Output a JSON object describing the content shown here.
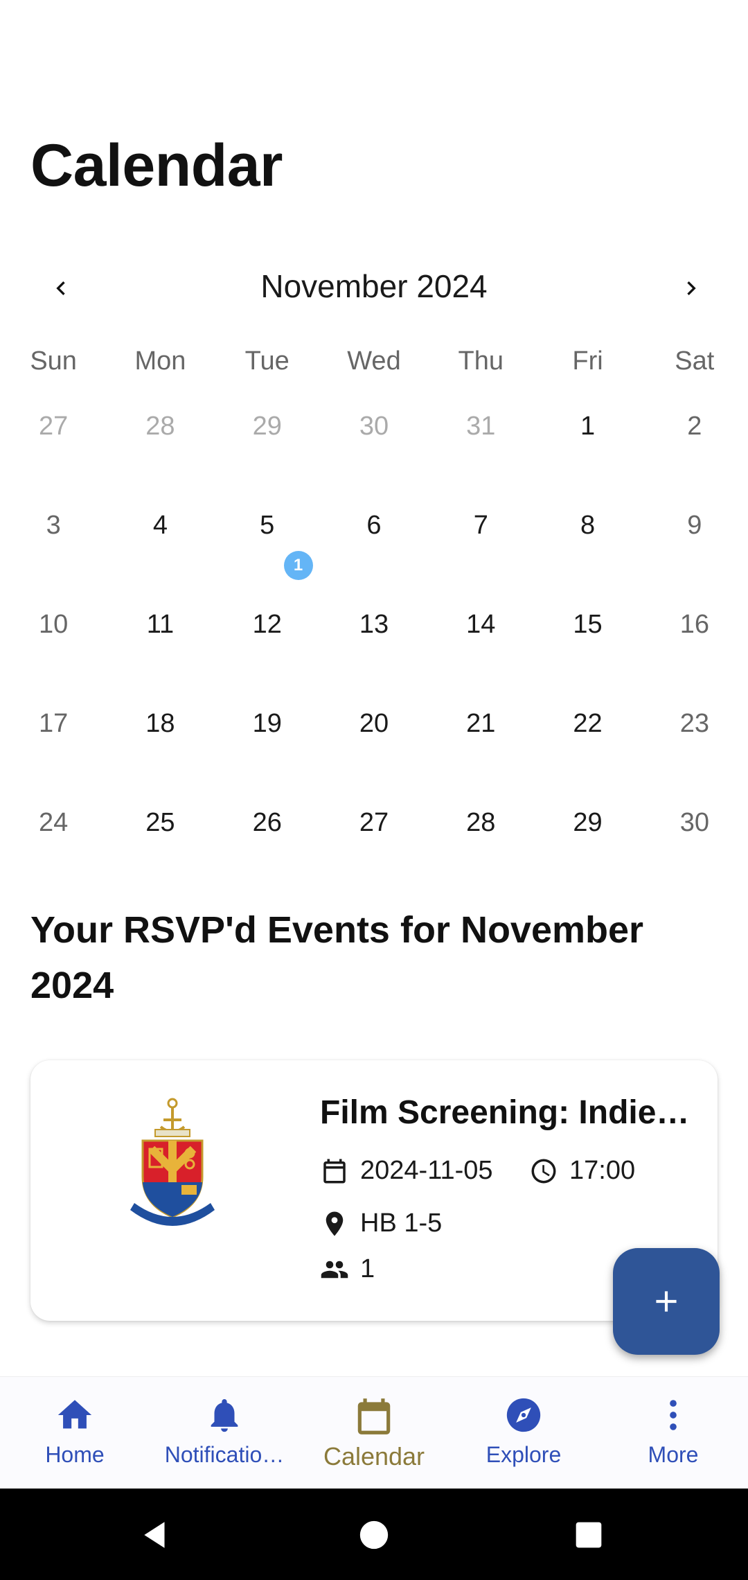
{
  "header": {
    "title": "Calendar"
  },
  "calendar": {
    "month_label": "November 2024",
    "weekdays": [
      "Sun",
      "Mon",
      "Tue",
      "Wed",
      "Thu",
      "Fri",
      "Sat"
    ],
    "weeks": [
      [
        "27",
        "28",
        "29",
        "30",
        "31",
        "1",
        "2"
      ],
      [
        "3",
        "4",
        "5",
        "6",
        "7",
        "8",
        "9"
      ],
      [
        "10",
        "11",
        "12",
        "13",
        "14",
        "15",
        "16"
      ],
      [
        "17",
        "18",
        "19",
        "20",
        "21",
        "22",
        "23"
      ],
      [
        "24",
        "25",
        "26",
        "27",
        "28",
        "29",
        "30"
      ]
    ],
    "event_badge_count": "1",
    "colors": {
      "badge": "#64b5f6"
    }
  },
  "section": {
    "title": "Your RSVP'd Events for November 2024"
  },
  "event": {
    "title": "Film Screening: Indie…",
    "date": "2024-11-05",
    "time": "17:00",
    "location": "HB 1-5",
    "attendees": "1",
    "icons": [
      "calendar-icon",
      "clock-icon",
      "location-pin-icon",
      "people-icon"
    ]
  },
  "fab": {
    "icon": "plus-icon",
    "color": "#2f5597"
  },
  "bottom_nav": {
    "items": [
      {
        "label": "Home",
        "icon": "home-icon"
      },
      {
        "label": "Notificatio…",
        "icon": "bell-icon"
      },
      {
        "label": "Calendar",
        "icon": "calendar-icon"
      },
      {
        "label": "Explore",
        "icon": "compass-icon"
      },
      {
        "label": "More",
        "icon": "more-vertical-icon"
      }
    ],
    "active_index": 2,
    "colors": {
      "inactive": "#2f4fb8",
      "active": "#8b7a3a"
    }
  }
}
